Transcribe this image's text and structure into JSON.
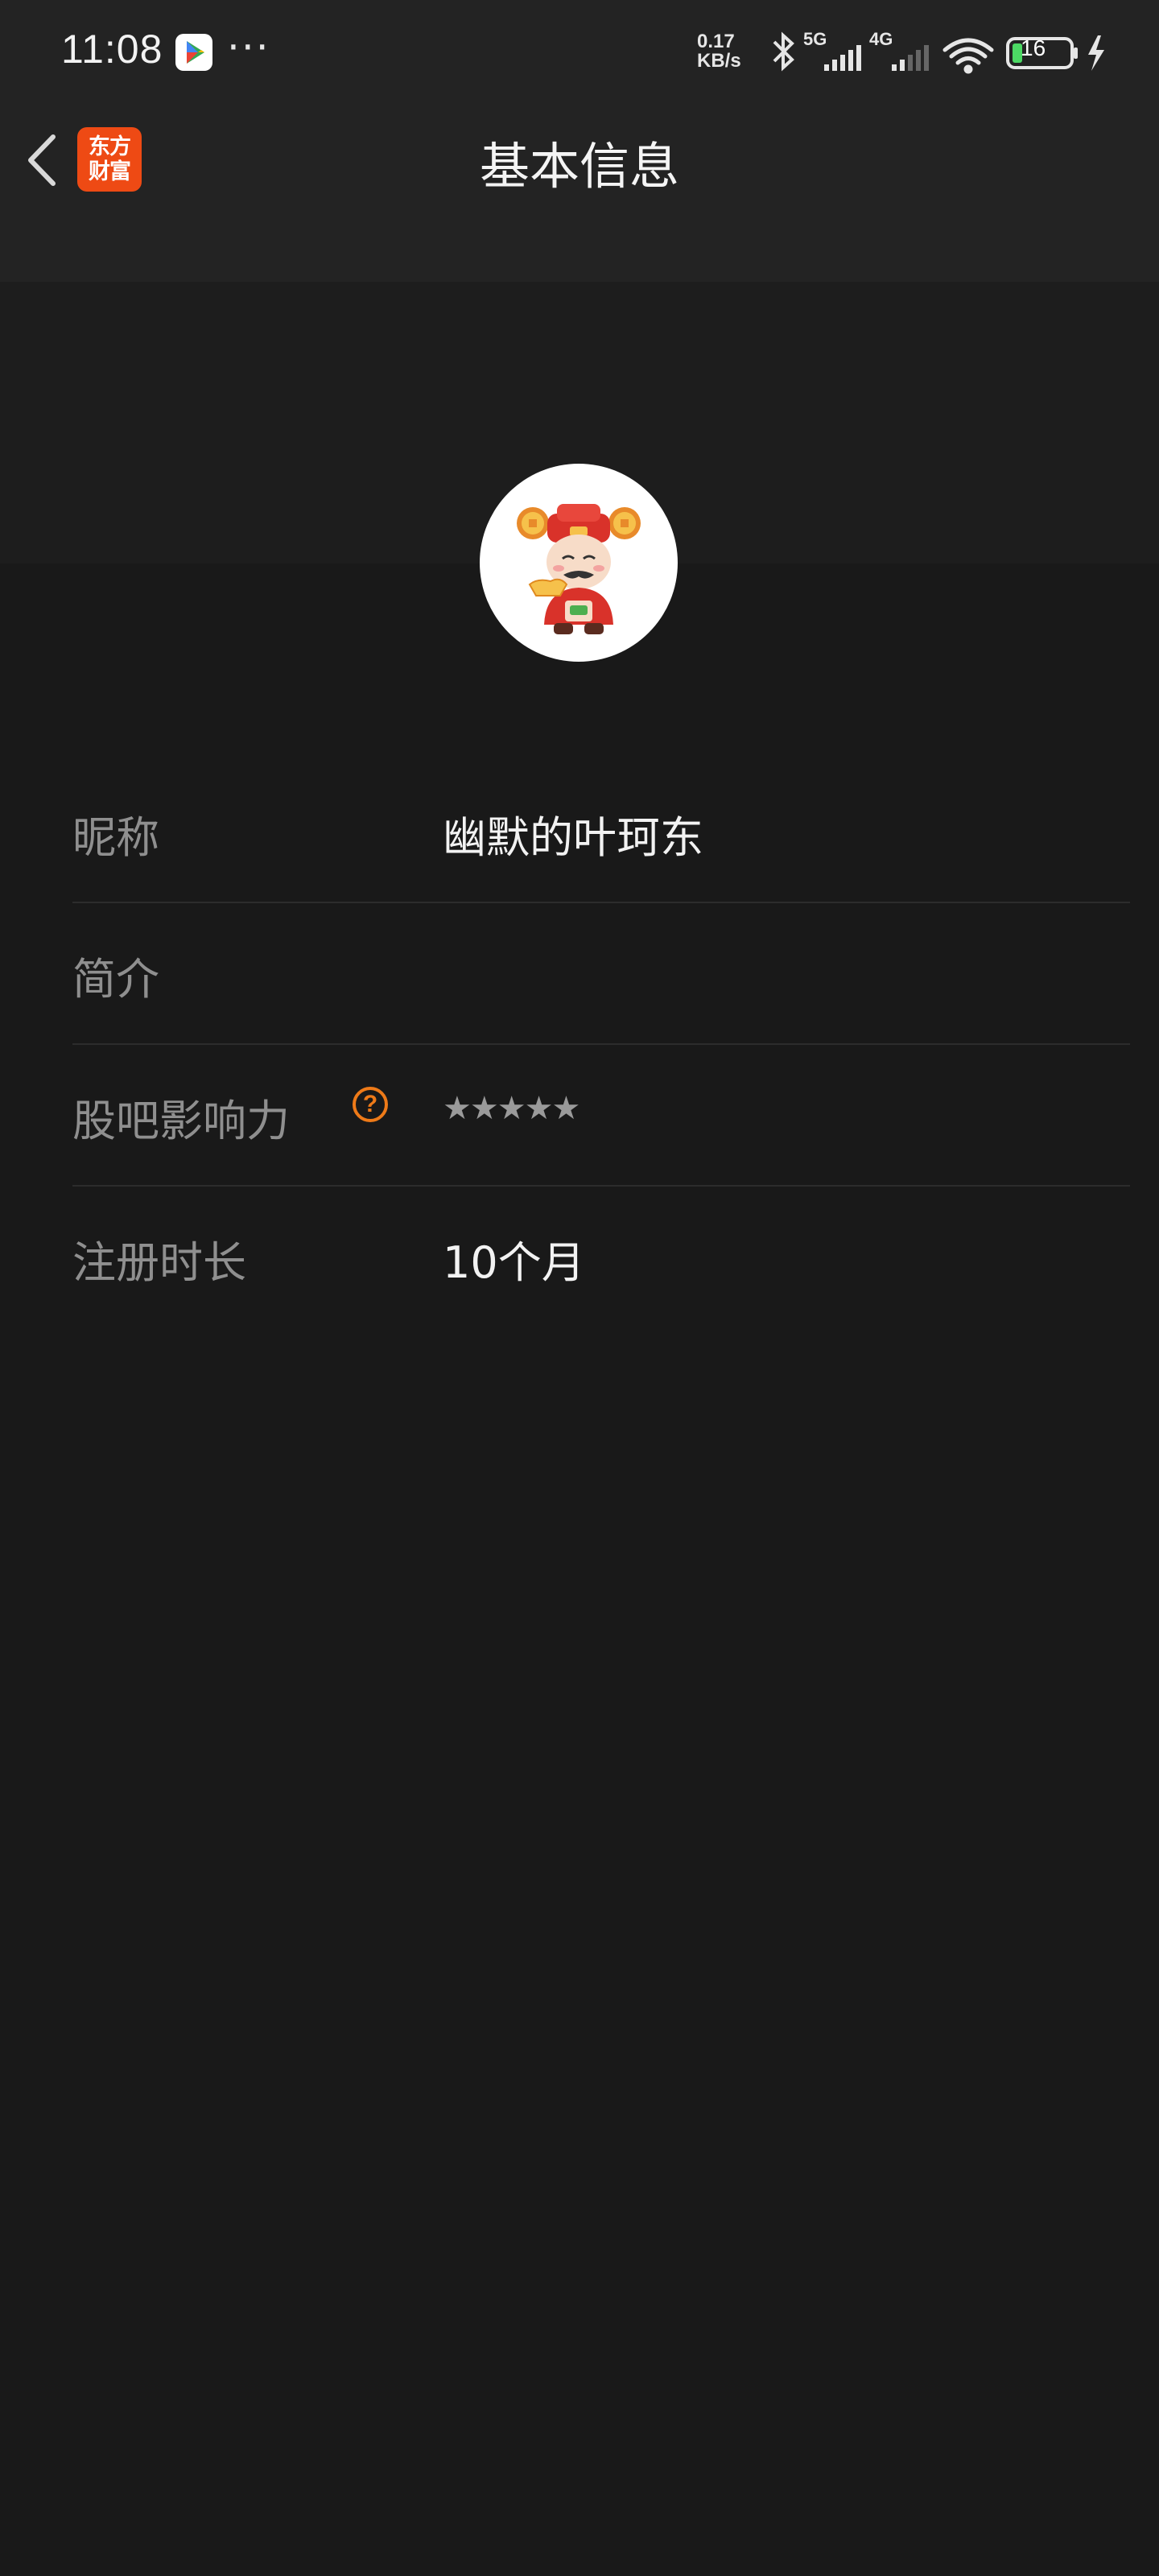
{
  "status_bar": {
    "time": "11:08",
    "more": "···",
    "speed_value": "0.17",
    "speed_unit": "KB/s",
    "network_5g": "5G",
    "network_4g": "4G",
    "battery": "16"
  },
  "nav": {
    "logo_line1": "东方",
    "logo_line2": "财富",
    "title": "基本信息"
  },
  "profile": {
    "rows": [
      {
        "label": "昵称",
        "value": "幽默的叶珂东"
      },
      {
        "label": "简介",
        "value": ""
      },
      {
        "label": "股吧影响力",
        "value": "★★★★★",
        "help": "?",
        "stars_filled": 0,
        "stars_total": 5
      },
      {
        "label": "注册时长",
        "value": "10个月"
      }
    ]
  },
  "colors": {
    "background": "#191919",
    "accent": "#ee7a18",
    "logo": "#ee4a14",
    "label": "#8f8f8f"
  }
}
